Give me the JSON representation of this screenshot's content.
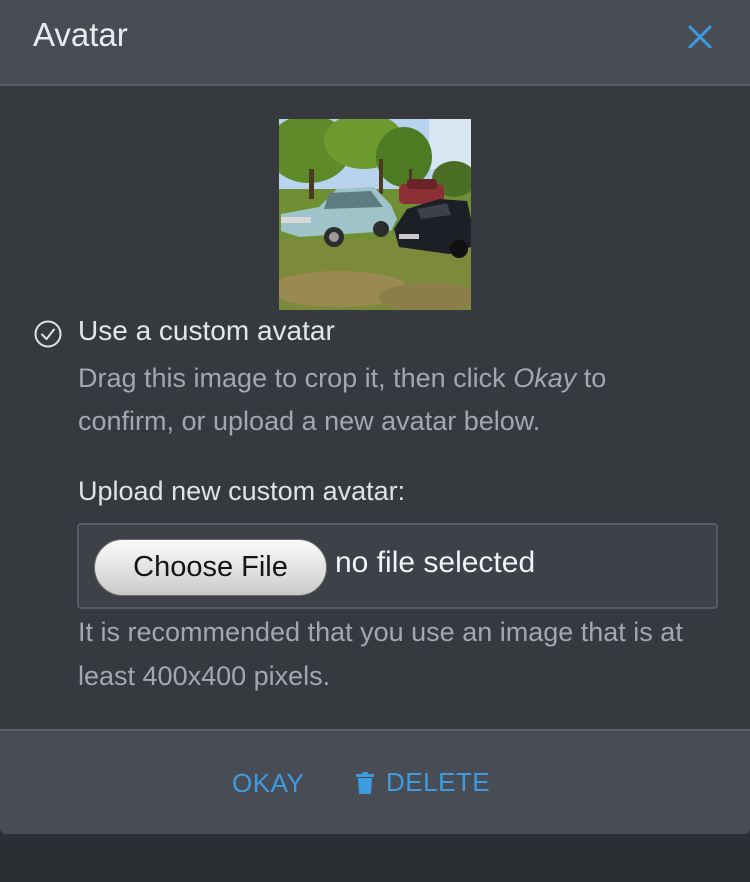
{
  "dialog": {
    "title": "Avatar",
    "close_icon": "close-icon"
  },
  "avatar": {
    "option_label": "Use a custom avatar",
    "help_prefix": "Drag this image to crop it, then click ",
    "help_emphasis": "Okay",
    "help_suffix": " to confirm, or upload a new avatar below.",
    "upload_label": "Upload new custom avatar:",
    "choose_button": "Choose File",
    "file_status": "no file selected",
    "recommendation": "It is recommended that you use an image that is at least 400x400 pixels."
  },
  "footer": {
    "okay_label": "OKAY",
    "delete_label": "DELETE",
    "delete_icon": "trash-icon"
  },
  "colors": {
    "accent": "#3f9bdf",
    "header_bg": "#484c55",
    "body_bg": "#36393e"
  }
}
